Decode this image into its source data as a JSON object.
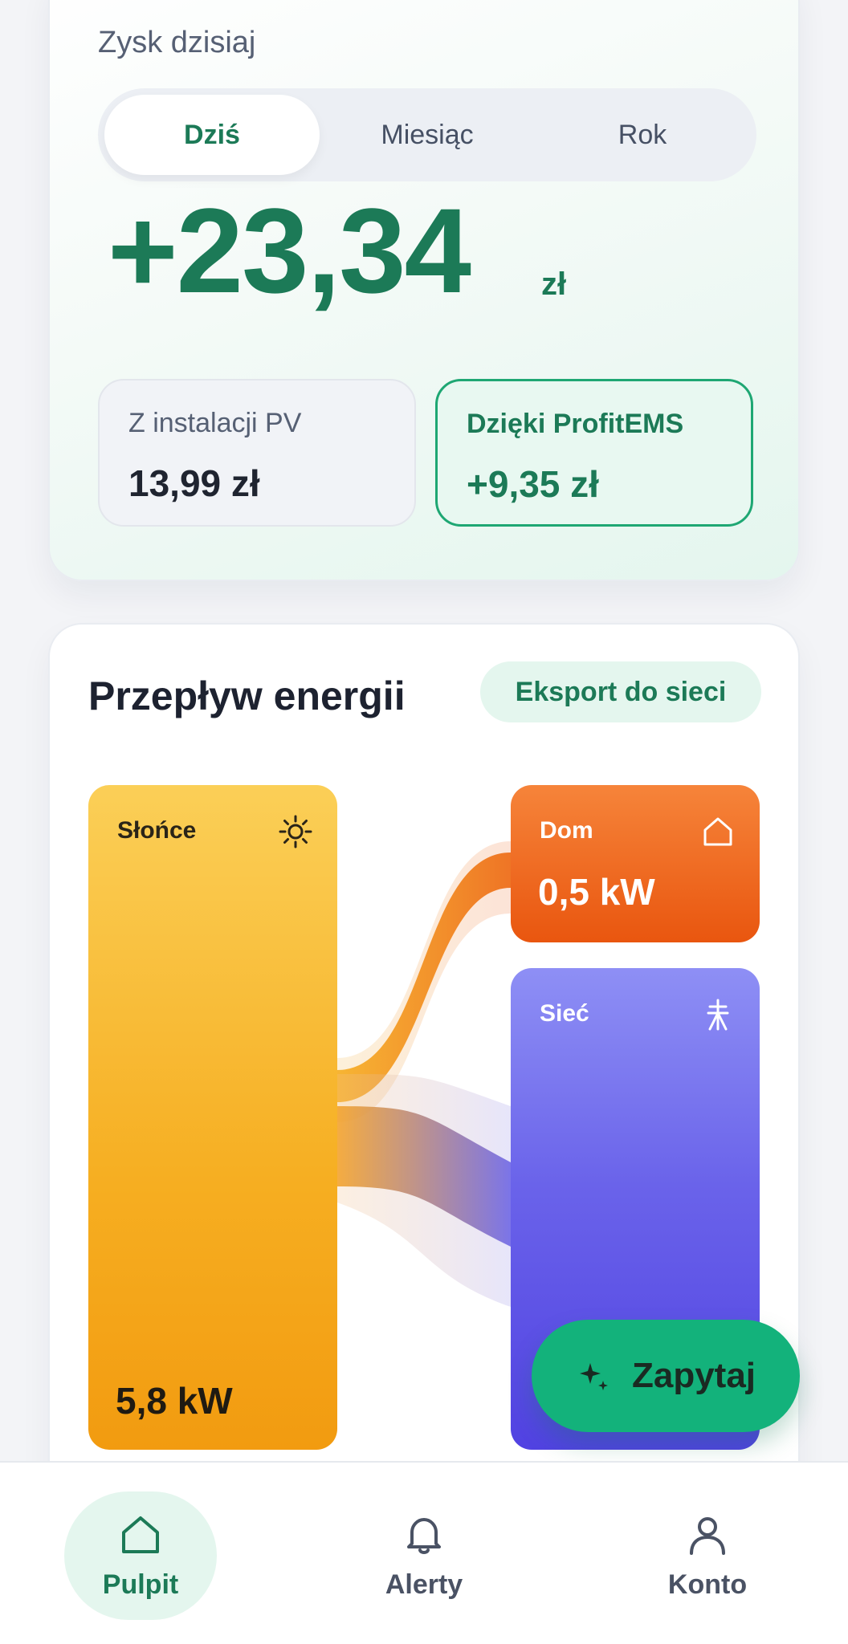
{
  "profit": {
    "title": "Zysk dzisiaj",
    "tabs": [
      {
        "label": "Dziś",
        "active": true
      },
      {
        "label": "Miesiąc",
        "active": false
      },
      {
        "label": "Rok",
        "active": false
      }
    ],
    "amount": "+23,34",
    "unit": "zł",
    "breakdown": {
      "pv_label": "Z instalacji PV",
      "pv_value": "13,99 zł",
      "ems_label": "Dzięki ProfitEMS",
      "ems_value": "+9,35 zł"
    }
  },
  "energy_flow": {
    "title": "Przepływ energii",
    "status_chip": "Eksport do sieci",
    "sources": [
      {
        "name": "Słońce",
        "value": "5,8 kW",
        "icon": "sun-icon",
        "color": "#f6ae21"
      }
    ],
    "targets": [
      {
        "name": "Dom",
        "value": "0,5 kW",
        "icon": "home-icon",
        "color": "#e9560f"
      },
      {
        "name": "Sieć",
        "value": "",
        "icon": "power-pylon-icon",
        "color": "#5142e2"
      }
    ]
  },
  "fab": {
    "label": "Zapytaj",
    "icon": "sparkles-icon"
  },
  "bottom_nav": [
    {
      "label": "Pulpit",
      "icon": "home-icon",
      "active": true
    },
    {
      "label": "Alerty",
      "icon": "bell-icon",
      "active": false
    },
    {
      "label": "Konto",
      "icon": "user-icon",
      "active": false
    }
  ],
  "colors": {
    "brand_green": "#1c7a57",
    "accent_green": "#13b27b",
    "sun": "#f6ae21",
    "home": "#e9560f",
    "grid": "#5142e2"
  }
}
